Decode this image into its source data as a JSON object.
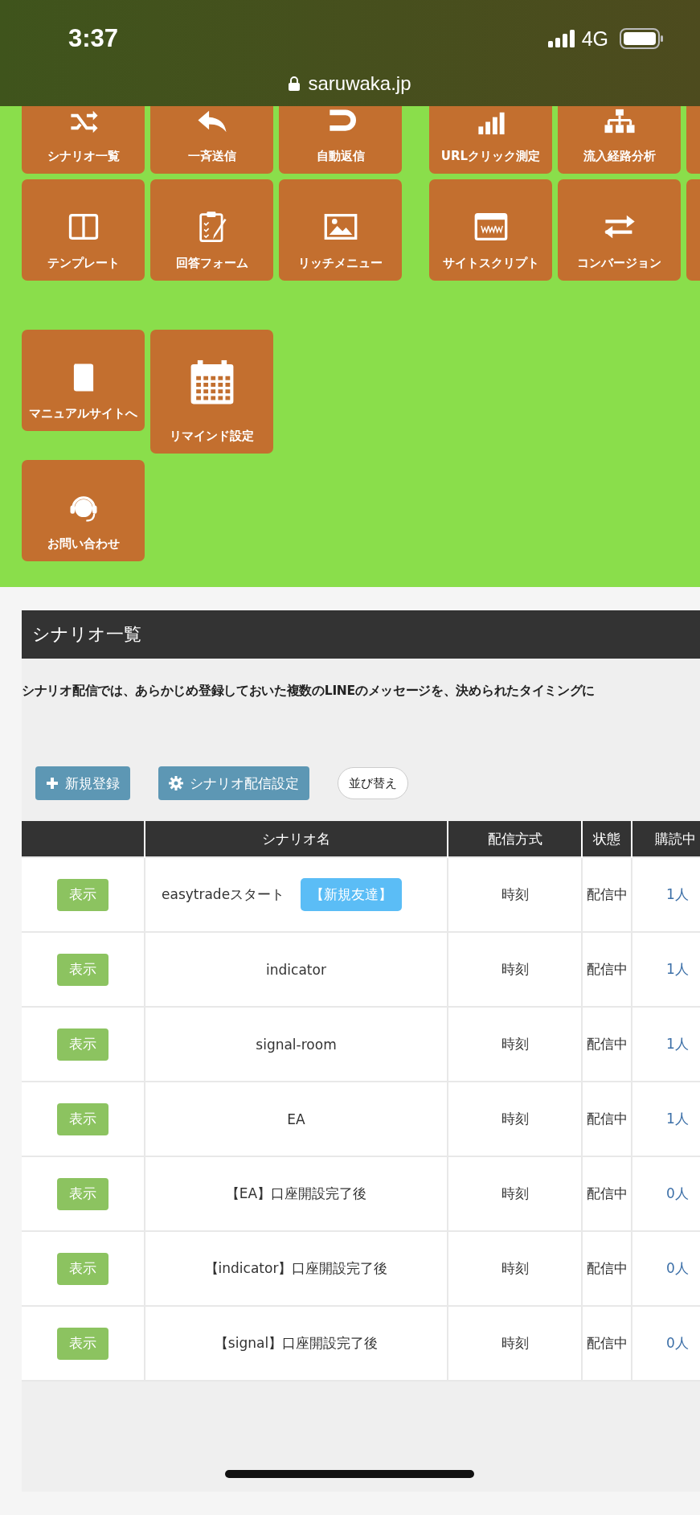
{
  "status_bar": {
    "time": "3:37",
    "network": "4G",
    "url": "saruwaka.jp"
  },
  "tile_groups": [
    {
      "tiles": [
        {
          "label": "シナリオ一覧"
        },
        {
          "label": "一斉送信"
        },
        {
          "label": "自動返信"
        },
        {
          "label": "テンプレート"
        },
        {
          "label": "回答フォーム"
        },
        {
          "label": "リッチメニュー"
        }
      ]
    },
    {
      "tiles": [
        {
          "label": "URLクリック測定"
        },
        {
          "label": "流入経路分析"
        },
        {
          "label": "サイトスクリプト"
        },
        {
          "label": "コンバージョン"
        }
      ]
    }
  ],
  "extra_tiles": [
    {
      "label": "マニュアルサイトへ",
      "kind": "normal"
    },
    {
      "label": "リマインド設定",
      "kind": "large"
    },
    {
      "label": "お問い合わせ",
      "kind": "normal"
    }
  ],
  "panel": {
    "title": "シナリオ一覧",
    "description": "シナリオ配信では、あらかじめ登録しておいた複数のLINEのメッセージを、決められたタイミングに",
    "buttons": [
      {
        "label": "新規登録",
        "kind": "add"
      },
      {
        "label": "シナリオ配信設定",
        "kind": "settings"
      },
      {
        "label": "並び替え",
        "kind": "plain"
      }
    ],
    "table": {
      "columns": [
        "シナリオ名",
        "配信方式",
        "状態",
        "購読中"
      ],
      "rows": [
        {
          "action": "表示",
          "name": "easytradeスタート",
          "tag": "【新規友達】",
          "method": "時刻",
          "status": "配信中",
          "subscribers": "1人"
        },
        {
          "action": "表示",
          "name": "indicator",
          "method": "時刻",
          "status": "配信中",
          "subscribers": "1人"
        },
        {
          "action": "表示",
          "name": "signal-room",
          "method": "時刻",
          "status": "配信中",
          "subscribers": "1人"
        },
        {
          "action": "表示",
          "name": "EA",
          "method": "時刻",
          "status": "配信中",
          "subscribers": "1人"
        },
        {
          "action": "表示",
          "name": "【EA】口座開設完了後",
          "method": "時刻",
          "status": "配信中",
          "subscribers": "0人"
        },
        {
          "action": "表示",
          "name": "【indicator】口座開設完了後",
          "method": "時刻",
          "status": "配信中",
          "subscribers": "0人"
        },
        {
          "action": "表示",
          "name": "【signal】口座開設完了後",
          "method": "時刻",
          "status": "配信中",
          "subscribers": "0人"
        }
      ]
    }
  }
}
